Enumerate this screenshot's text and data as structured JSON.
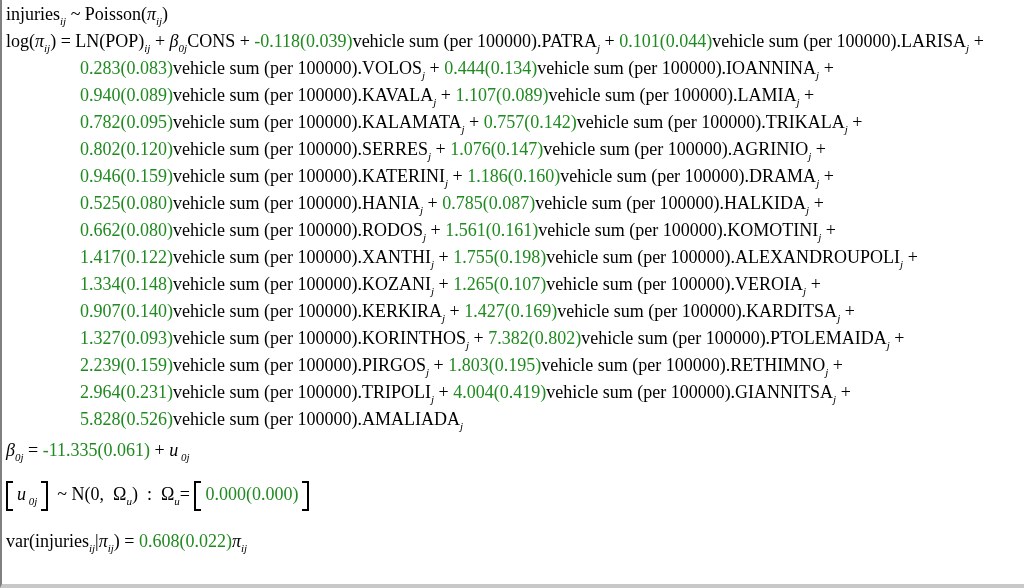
{
  "equations": [
    {
      "kind": "model",
      "segments": [
        {
          "kind": "t",
          "text": "injuries"
        },
        {
          "kind": "s",
          "text": "ij"
        },
        {
          "kind": "t",
          "text": " ~ Poisson("
        },
        {
          "kind": "i",
          "text": "π"
        },
        {
          "kind": "s",
          "text": "ij"
        },
        {
          "kind": "t",
          "text": ")"
        }
      ]
    },
    {
      "kind": "model",
      "segments": [
        {
          "kind": "t",
          "text": "log("
        },
        {
          "kind": "i",
          "text": "π"
        },
        {
          "kind": "s",
          "text": "ij"
        },
        {
          "kind": "t",
          "text": ") = LN(POP)"
        },
        {
          "kind": "s",
          "text": "ij"
        },
        {
          "kind": "t",
          "text": " + "
        },
        {
          "kind": "i",
          "text": "β"
        },
        {
          "kind": "s",
          "text": "0j"
        },
        {
          "kind": "t",
          "text": "CONS + "
        },
        {
          "kind": "e",
          "text": "-0.118(0.039)"
        },
        {
          "kind": "t",
          "text": "vehicle sum (per 100000).PATRA"
        },
        {
          "kind": "s",
          "text": "j"
        },
        {
          "kind": "t",
          "text": " + "
        },
        {
          "kind": "e",
          "text": "0.101(0.044)"
        },
        {
          "kind": "t",
          "text": "vehicle sum (per 100000).LARISA"
        },
        {
          "kind": "s",
          "text": "j"
        },
        {
          "kind": "t",
          "text": " +"
        }
      ]
    },
    {
      "kind": "continuation",
      "segments": [
        {
          "kind": "e",
          "text": "0.283(0.083)"
        },
        {
          "kind": "t",
          "text": "vehicle sum (per 100000).VOLOS"
        },
        {
          "kind": "s",
          "text": "j"
        },
        {
          "kind": "t",
          "text": " + "
        },
        {
          "kind": "e",
          "text": "0.444(0.134)"
        },
        {
          "kind": "t",
          "text": "vehicle sum (per 100000).IOANNINA"
        },
        {
          "kind": "s",
          "text": "j"
        },
        {
          "kind": "t",
          "text": " +"
        }
      ]
    },
    {
      "kind": "continuation",
      "segments": [
        {
          "kind": "e",
          "text": "0.940(0.089)"
        },
        {
          "kind": "t",
          "text": "vehicle sum (per 100000).KAVALA"
        },
        {
          "kind": "s",
          "text": "j"
        },
        {
          "kind": "t",
          "text": " + "
        },
        {
          "kind": "e",
          "text": "1.107(0.089)"
        },
        {
          "kind": "t",
          "text": "vehicle sum (per 100000).LAMIA"
        },
        {
          "kind": "s",
          "text": "j"
        },
        {
          "kind": "t",
          "text": " +"
        }
      ]
    },
    {
      "kind": "continuation",
      "segments": [
        {
          "kind": "e",
          "text": "0.782(0.095)"
        },
        {
          "kind": "t",
          "text": "vehicle sum (per 100000).KALAMATA"
        },
        {
          "kind": "s",
          "text": "j"
        },
        {
          "kind": "t",
          "text": " + "
        },
        {
          "kind": "e",
          "text": "0.757(0.142)"
        },
        {
          "kind": "t",
          "text": "vehicle sum (per 100000).TRIKALA"
        },
        {
          "kind": "s",
          "text": "j"
        },
        {
          "kind": "t",
          "text": " +"
        }
      ]
    },
    {
      "kind": "continuation",
      "segments": [
        {
          "kind": "e",
          "text": "0.802(0.120)"
        },
        {
          "kind": "t",
          "text": "vehicle sum (per 100000).SERRES"
        },
        {
          "kind": "s",
          "text": "j"
        },
        {
          "kind": "t",
          "text": " + "
        },
        {
          "kind": "e",
          "text": "1.076(0.147)"
        },
        {
          "kind": "t",
          "text": "vehicle sum (per 100000).AGRINIO"
        },
        {
          "kind": "s",
          "text": "j"
        },
        {
          "kind": "t",
          "text": " +"
        }
      ]
    },
    {
      "kind": "continuation",
      "segments": [
        {
          "kind": "e",
          "text": "0.946(0.159)"
        },
        {
          "kind": "t",
          "text": "vehicle sum (per 100000).KATERINI"
        },
        {
          "kind": "s",
          "text": "j"
        },
        {
          "kind": "t",
          "text": " + "
        },
        {
          "kind": "e",
          "text": "1.186(0.160)"
        },
        {
          "kind": "t",
          "text": "vehicle sum (per 100000).DRAMA"
        },
        {
          "kind": "s",
          "text": "j"
        },
        {
          "kind": "t",
          "text": " +"
        }
      ]
    },
    {
      "kind": "continuation",
      "segments": [
        {
          "kind": "e",
          "text": "0.525(0.080)"
        },
        {
          "kind": "t",
          "text": "vehicle sum (per 100000).HANIA"
        },
        {
          "kind": "s",
          "text": "j"
        },
        {
          "kind": "t",
          "text": " + "
        },
        {
          "kind": "e",
          "text": "0.785(0.087)"
        },
        {
          "kind": "t",
          "text": "vehicle sum (per 100000).HALKIDA"
        },
        {
          "kind": "s",
          "text": "j"
        },
        {
          "kind": "t",
          "text": " +"
        }
      ]
    },
    {
      "kind": "continuation",
      "segments": [
        {
          "kind": "e",
          "text": "0.662(0.080)"
        },
        {
          "kind": "t",
          "text": "vehicle sum (per 100000).RODOS"
        },
        {
          "kind": "s",
          "text": "j"
        },
        {
          "kind": "t",
          "text": " + "
        },
        {
          "kind": "e",
          "text": "1.561(0.161)"
        },
        {
          "kind": "t",
          "text": "vehicle sum (per 100000).KOMOTINI"
        },
        {
          "kind": "s",
          "text": "j"
        },
        {
          "kind": "t",
          "text": " +"
        }
      ]
    },
    {
      "kind": "continuation",
      "segments": [
        {
          "kind": "e",
          "text": "1.417(0.122)"
        },
        {
          "kind": "t",
          "text": "vehicle sum (per 100000).XANTHI"
        },
        {
          "kind": "s",
          "text": "j"
        },
        {
          "kind": "t",
          "text": " + "
        },
        {
          "kind": "e",
          "text": "1.755(0.198)"
        },
        {
          "kind": "t",
          "text": "vehicle sum (per 100000).ALEXANDROUPOLI"
        },
        {
          "kind": "s",
          "text": "j"
        },
        {
          "kind": "t",
          "text": " +"
        }
      ]
    },
    {
      "kind": "continuation",
      "segments": [
        {
          "kind": "e",
          "text": "1.334(0.148)"
        },
        {
          "kind": "t",
          "text": "vehicle sum (per 100000).KOZANI"
        },
        {
          "kind": "s",
          "text": "j"
        },
        {
          "kind": "t",
          "text": " + "
        },
        {
          "kind": "e",
          "text": "1.265(0.107)"
        },
        {
          "kind": "t",
          "text": "vehicle sum (per 100000).VEROIA"
        },
        {
          "kind": "s",
          "text": "j"
        },
        {
          "kind": "t",
          "text": " +"
        }
      ]
    },
    {
      "kind": "continuation",
      "segments": [
        {
          "kind": "e",
          "text": "0.907(0.140)"
        },
        {
          "kind": "t",
          "text": "vehicle sum (per 100000).KERKIRA"
        },
        {
          "kind": "s",
          "text": "j"
        },
        {
          "kind": "t",
          "text": " + "
        },
        {
          "kind": "e",
          "text": "1.427(0.169)"
        },
        {
          "kind": "t",
          "text": "vehicle sum (per 100000).KARDITSA"
        },
        {
          "kind": "s",
          "text": "j"
        },
        {
          "kind": "t",
          "text": " +"
        }
      ]
    },
    {
      "kind": "continuation",
      "segments": [
        {
          "kind": "e",
          "text": "1.327(0.093)"
        },
        {
          "kind": "t",
          "text": "vehicle sum (per 100000).KORINTHOS"
        },
        {
          "kind": "s",
          "text": "j"
        },
        {
          "kind": "t",
          "text": " + "
        },
        {
          "kind": "e",
          "text": "7.382(0.802)"
        },
        {
          "kind": "t",
          "text": "vehicle sum (per 100000).PTOLEMAIDA"
        },
        {
          "kind": "s",
          "text": "j"
        },
        {
          "kind": "t",
          "text": " +"
        }
      ]
    },
    {
      "kind": "continuation",
      "segments": [
        {
          "kind": "e",
          "text": "2.239(0.159)"
        },
        {
          "kind": "t",
          "text": "vehicle sum (per 100000).PIRGOS"
        },
        {
          "kind": "s",
          "text": "j"
        },
        {
          "kind": "t",
          "text": " + "
        },
        {
          "kind": "e",
          "text": "1.803(0.195)"
        },
        {
          "kind": "t",
          "text": "vehicle sum (per 100000).RETHIMNO"
        },
        {
          "kind": "s",
          "text": "j"
        },
        {
          "kind": "t",
          "text": " +"
        }
      ]
    },
    {
      "kind": "continuation",
      "segments": [
        {
          "kind": "e",
          "text": "2.964(0.231)"
        },
        {
          "kind": "t",
          "text": "vehicle sum (per 100000).TRIPOLI"
        },
        {
          "kind": "s",
          "text": "j"
        },
        {
          "kind": "t",
          "text": " + "
        },
        {
          "kind": "e",
          "text": "4.004(0.419)"
        },
        {
          "kind": "t",
          "text": "vehicle sum (per 100000).GIANNITSA"
        },
        {
          "kind": "s",
          "text": "j"
        },
        {
          "kind": "t",
          "text": " +"
        }
      ]
    },
    {
      "kind": "continuation",
      "segments": [
        {
          "kind": "e",
          "text": "5.828(0.526)"
        },
        {
          "kind": "t",
          "text": "vehicle sum (per 100000).AMALIADA"
        },
        {
          "kind": "s",
          "text": "j"
        }
      ]
    },
    {
      "kind": "level2",
      "segments": [
        {
          "kind": "i",
          "text": "β"
        },
        {
          "kind": "s",
          "text": "0j"
        },
        {
          "kind": "t",
          "text": " = "
        },
        {
          "kind": "e",
          "text": "-11.335(0.061)"
        },
        {
          "kind": "t",
          "text": " + "
        },
        {
          "kind": "i",
          "text": "u"
        },
        {
          "kind": "s",
          "text": " 0j"
        }
      ]
    },
    {
      "kind": "matrix",
      "segments": [
        {
          "kind": "open"
        },
        {
          "kind": "i",
          "text": "u"
        },
        {
          "kind": "s",
          "text": " 0j"
        },
        {
          "kind": "close"
        },
        {
          "kind": "t",
          "text": "  ~ N(0,  Ω"
        },
        {
          "kind": "s",
          "text": "u"
        },
        {
          "kind": "t",
          "text": ")  :  Ω"
        },
        {
          "kind": "s",
          "text": "u"
        },
        {
          "kind": "t",
          "text": "= "
        },
        {
          "kind": "open"
        },
        {
          "kind": "e",
          "text": "0.000(0.000)"
        },
        {
          "kind": "close"
        }
      ]
    },
    {
      "kind": "variance",
      "segments": [
        {
          "kind": "t",
          "text": "var(injuries"
        },
        {
          "kind": "s",
          "text": "ij"
        },
        {
          "kind": "t",
          "text": "|"
        },
        {
          "kind": "i",
          "text": "π"
        },
        {
          "kind": "s",
          "text": "ij"
        },
        {
          "kind": "t",
          "text": ") = "
        },
        {
          "kind": "e",
          "text": "0.608(0.022)"
        },
        {
          "kind": "i",
          "text": "π"
        },
        {
          "kind": "s",
          "text": "ij"
        }
      ]
    }
  ]
}
